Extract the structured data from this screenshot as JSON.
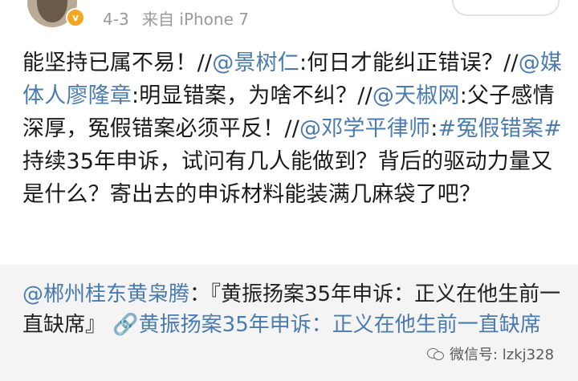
{
  "header": {
    "date": "4-3",
    "source": "来自 iPhone 7",
    "badge_glyph": "v"
  },
  "post": {
    "p1": "能坚持已属不易！//",
    "m1": "@景树仁",
    "p2": ":何日才能纠正错误？//",
    "m2": "@媒体人廖隆章",
    "p3": ":明显错案，为啥不纠？//",
    "m3": "@天椒网",
    "p4": ":父子感情深厚，冤假错案必须平反！//",
    "m4": "@邓学平律师",
    "p5": ":",
    "tag": "#冤假错案#",
    "p6": " 持续35年申诉，试问有几人能做到？背后的驱动力量又是什么？寄出去的申诉材料能装满几麻袋了吧？"
  },
  "repost": {
    "author": "@郴州桂东黄枭腾",
    "text": "：『黄振扬案35年申诉：正义在他生前一直缺席』",
    "link_text": "黄振扬案35年申诉：正义在他生前一直缺席"
  },
  "watermark": {
    "text": "微信号: lzkj328"
  },
  "colors": {
    "link": "#4a7bb0",
    "meta": "#9a9a9a",
    "repost_bg": "#f4f4f4"
  }
}
